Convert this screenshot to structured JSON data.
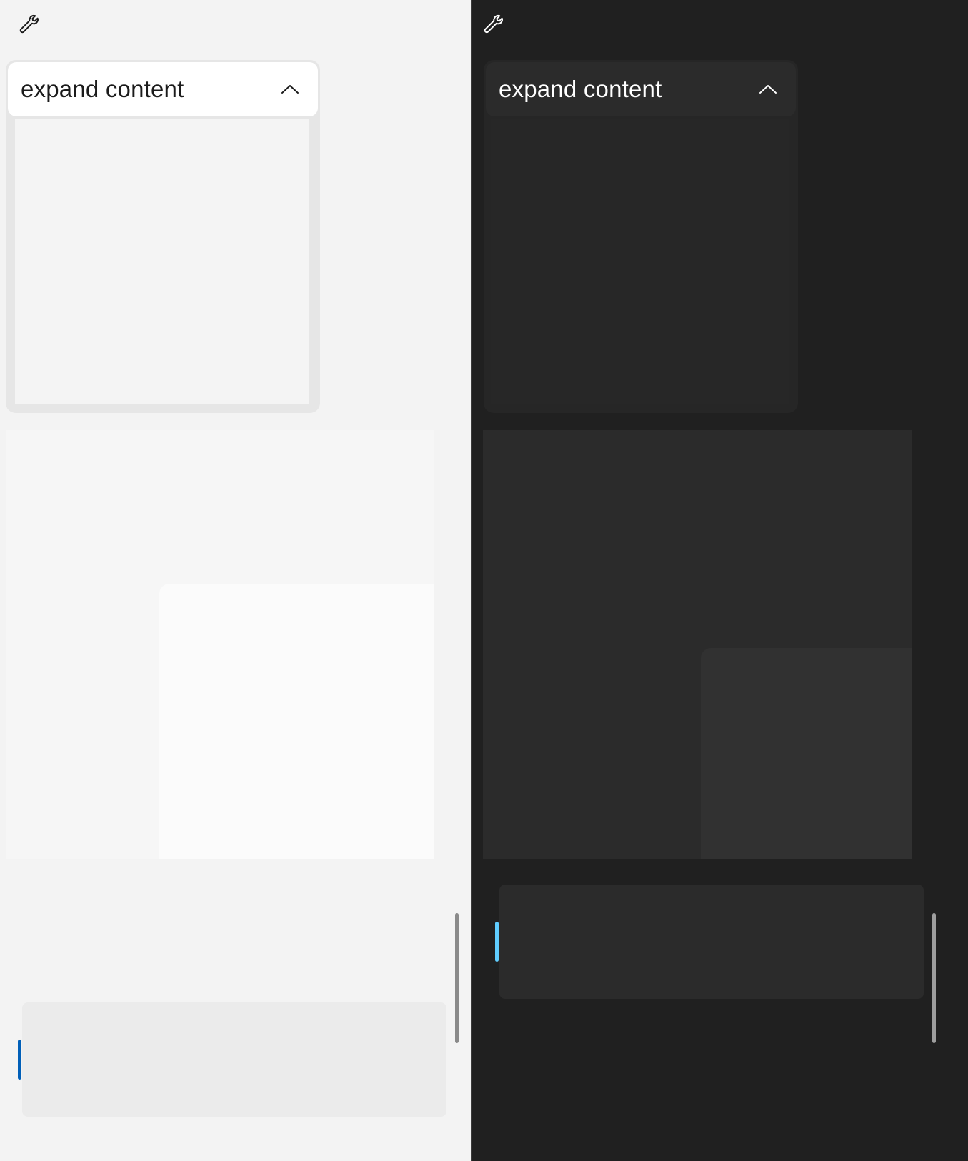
{
  "themes": {
    "light": {
      "label": "light",
      "expander": {
        "title": "expand content",
        "expanded": true
      },
      "icons": {
        "settings": "wrench-icon",
        "chevron": "chevron-up-icon"
      },
      "colors": {
        "background": "#f3f3f3",
        "accent": "#005fb8",
        "text": "#1b1b1b"
      }
    },
    "dark": {
      "label": "dark",
      "expander": {
        "title": "expand content",
        "expanded": true
      },
      "icons": {
        "settings": "wrench-icon",
        "chevron": "chevron-up-icon"
      },
      "colors": {
        "background": "#202020",
        "accent": "#60cdff",
        "text": "#ffffff"
      }
    }
  }
}
